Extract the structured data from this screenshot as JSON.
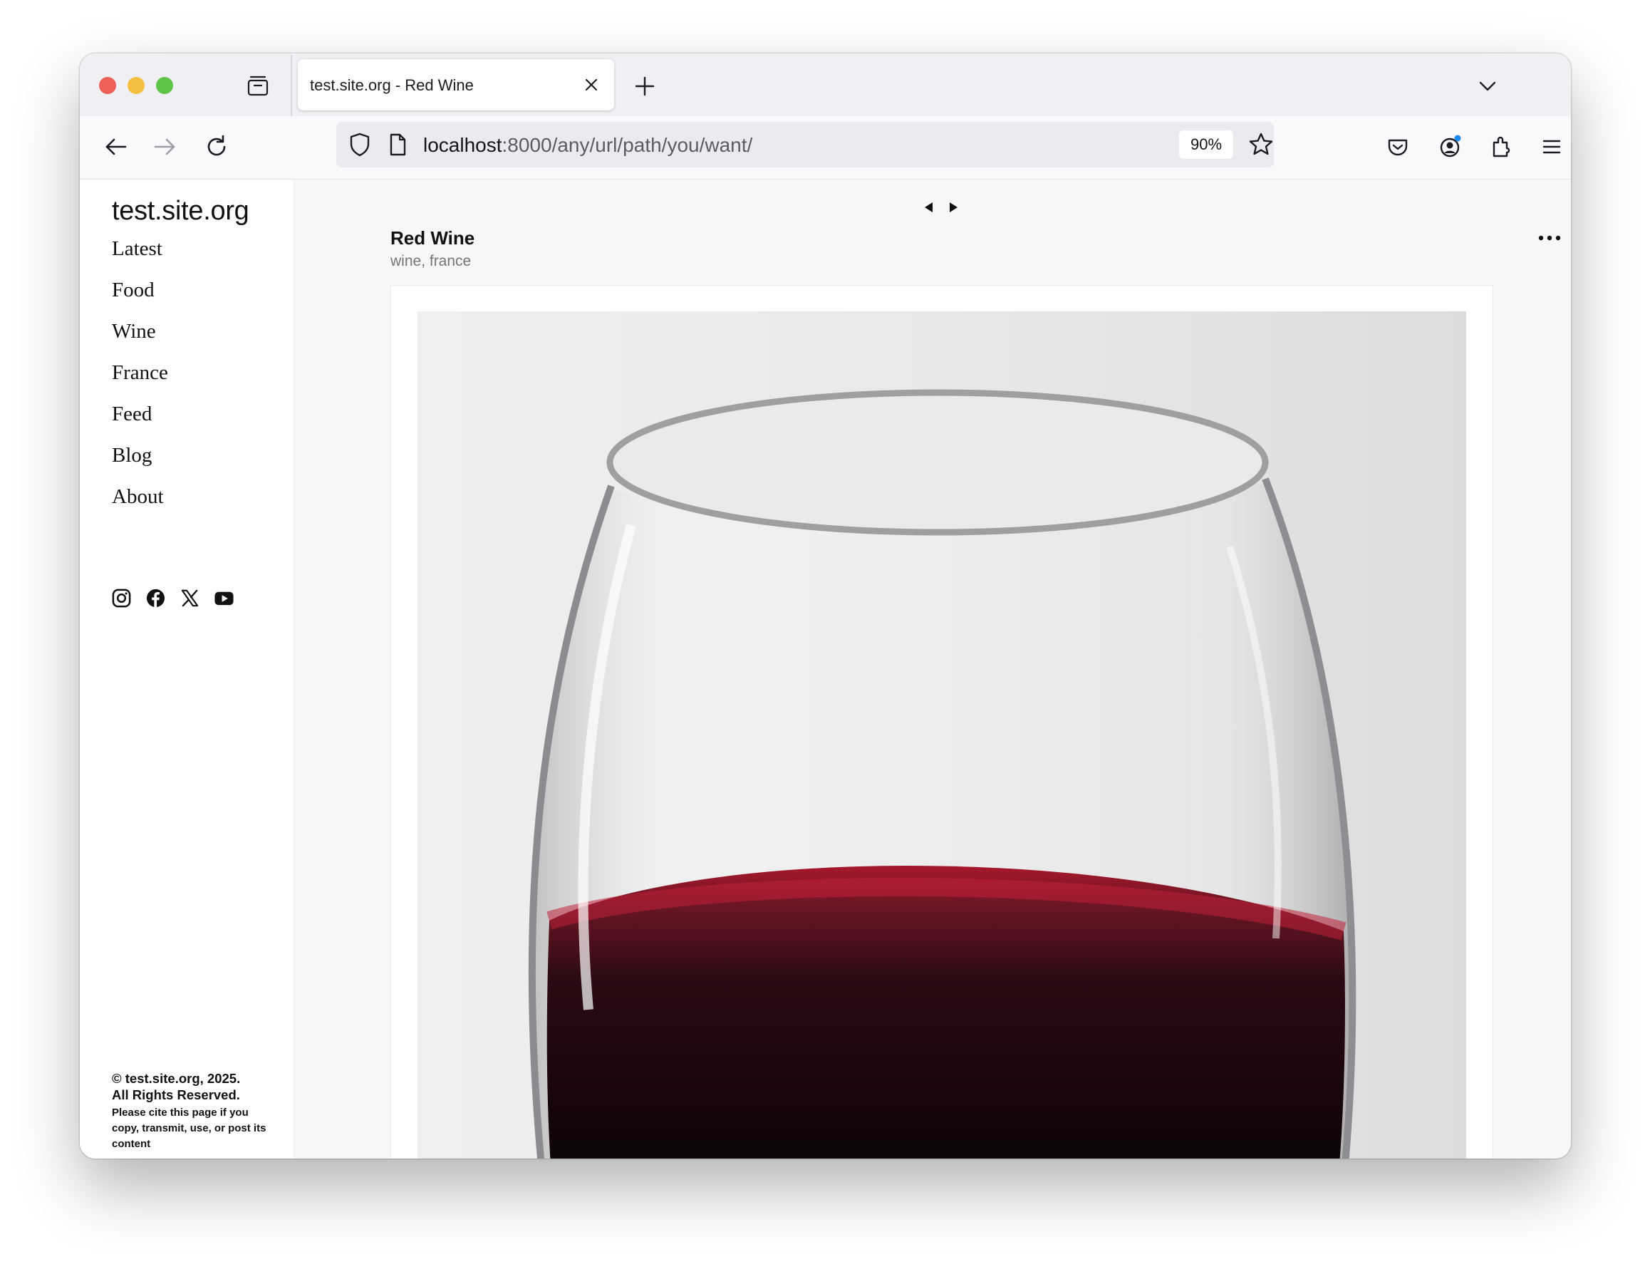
{
  "browser": {
    "tab": {
      "title": "test.site.org - Red Wine"
    },
    "url": {
      "host": "localhost",
      "path": ":8000/any/url/path/you/want/"
    },
    "zoom": "90%"
  },
  "site": {
    "title": "test.site.org",
    "nav": [
      "Latest",
      "Food",
      "Wine",
      "France",
      "Feed",
      "Blog",
      "About"
    ],
    "social": [
      "instagram-icon",
      "facebook-icon",
      "x-icon",
      "youtube-icon"
    ],
    "footer": {
      "copyright_line1": "© test.site.org, 2025.",
      "copyright_line2": "All Rights Reserved.",
      "cite": "Please cite this page if you copy, transmit, use, or post its content"
    }
  },
  "post": {
    "title": "Red Wine",
    "tags": "wine, france",
    "image": "wine glass with red wine"
  },
  "colors": {
    "wine": "#7a0d1c",
    "traffic_red": "#ee5f57",
    "traffic_yellow": "#f4be3e",
    "traffic_green": "#5ec347"
  }
}
